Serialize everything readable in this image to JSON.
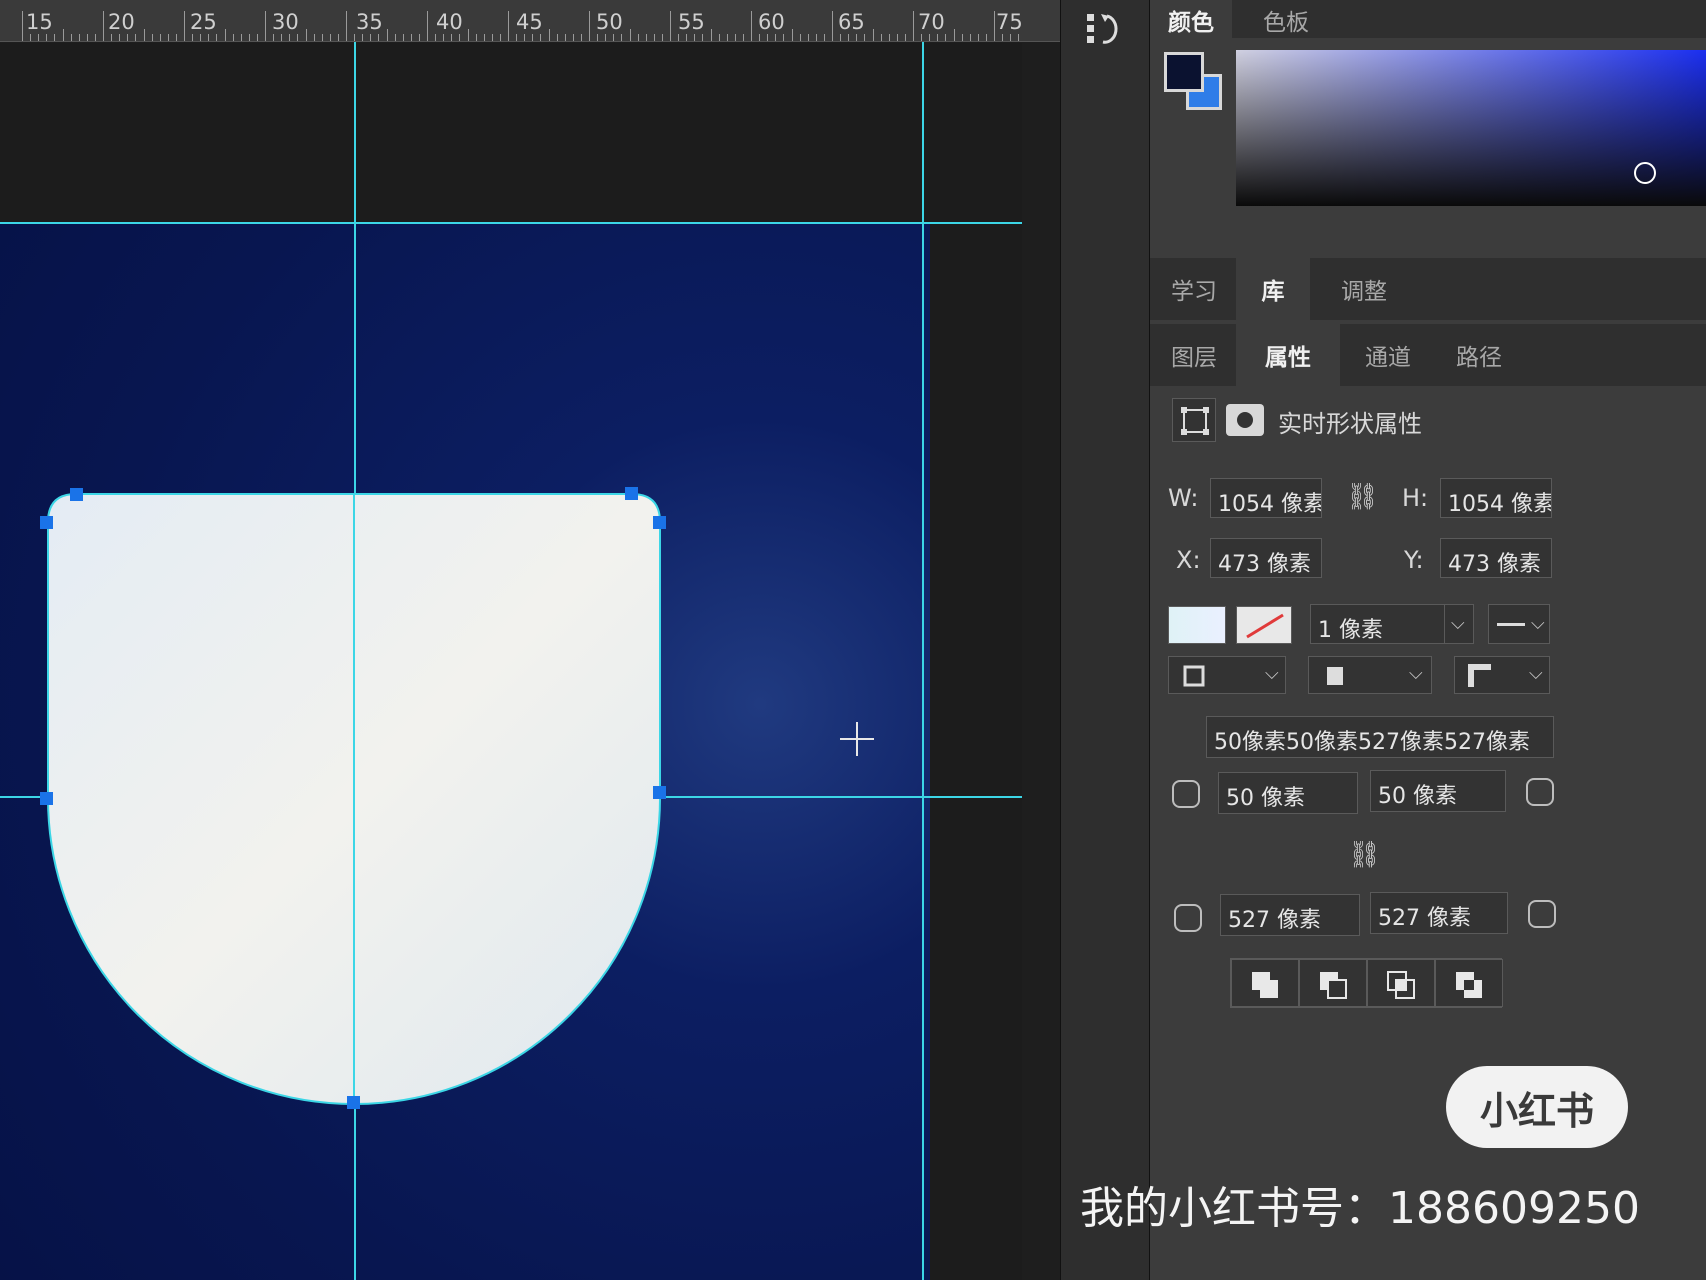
{
  "ruler": {
    "labels": [
      "15",
      "20",
      "25",
      "30",
      "35",
      "40",
      "45",
      "50",
      "55",
      "60",
      "65",
      "70",
      "75"
    ]
  },
  "panels": {
    "color_tabs": [
      "颜色",
      "色板"
    ],
    "color_active_tab": "颜色",
    "learn_tabs": [
      "学习",
      "库",
      "调整"
    ],
    "learn_active_tab": "库",
    "layer_tabs": [
      "图层",
      "属性",
      "通道",
      "路径"
    ],
    "layer_active_tab": "属性",
    "foreground_color": "#0b1230",
    "background_color": "#2f7de8"
  },
  "properties": {
    "title": "实时形状属性",
    "w_label": "W:",
    "w_value": "1054 像素",
    "h_label": "H:",
    "h_value": "1054 像素",
    "x_label": "X:",
    "x_value": "473 像素",
    "y_label": "Y:",
    "y_value": "473 像素",
    "stroke_width": "1 像素",
    "corner_summary": "50像素50像素527像素527像素",
    "corner_tl": "50 像素",
    "corner_tr": "50 像素",
    "corner_bl": "527 像素",
    "corner_br": "527 像素"
  },
  "watermark": {
    "badge": "小红书",
    "account": "我的小红书号：188609250"
  },
  "colors": {
    "guide": "#3cd6e6",
    "anchor": "#1a73e8",
    "shape_fill": "#e9eef2",
    "artboard": "#0a1a5e"
  }
}
